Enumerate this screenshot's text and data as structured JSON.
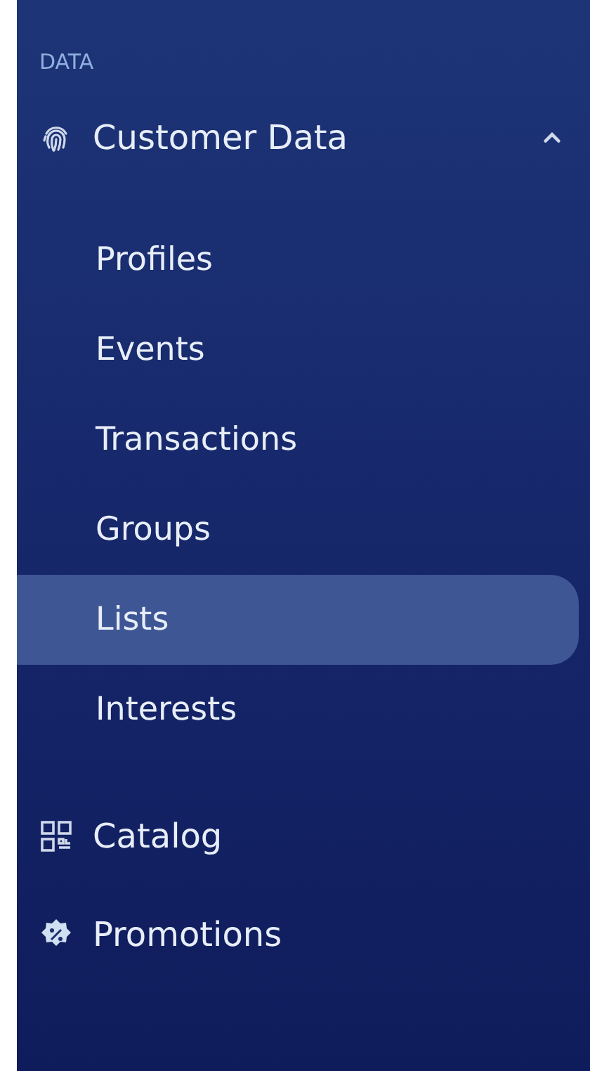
{
  "section_label": "DATA",
  "nav": [
    {
      "label": "Customer Data",
      "kind": "fingerprint",
      "expanded": true,
      "children": [
        {
          "label": "Profiles",
          "selected": false
        },
        {
          "label": "Events",
          "selected": false
        },
        {
          "label": "Transactions",
          "selected": false
        },
        {
          "label": "Groups",
          "selected": false
        },
        {
          "label": "Lists",
          "selected": true
        },
        {
          "label": "Interests",
          "selected": false
        }
      ]
    },
    {
      "label": "Catalog",
      "kind": "qr"
    },
    {
      "label": "Promotions",
      "kind": "badge"
    }
  ]
}
